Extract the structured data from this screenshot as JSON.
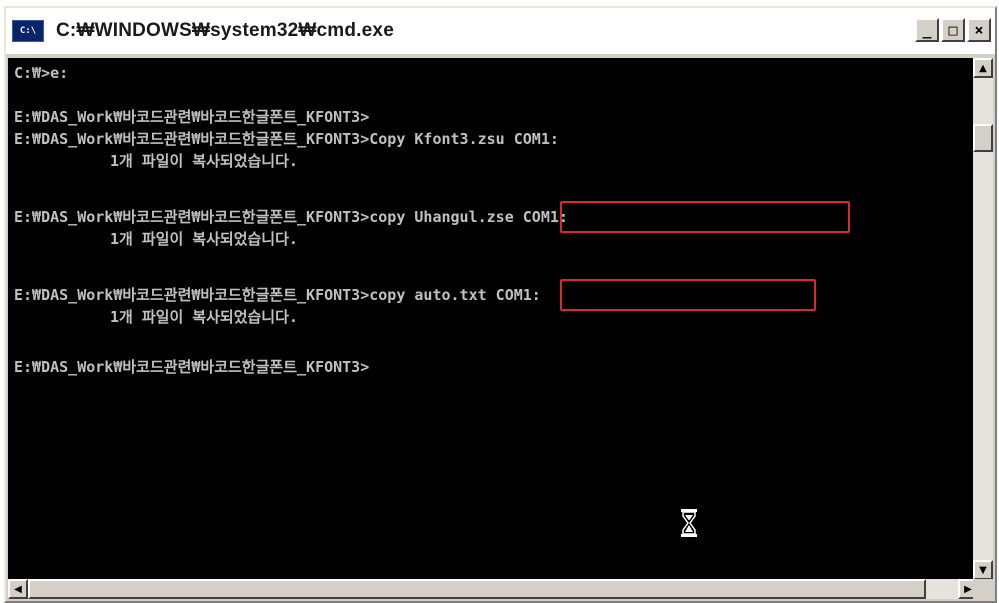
{
  "window": {
    "title": "C:₩WINDOWS₩system32₩cmd.exe",
    "icon": "cmd-console-icon",
    "icon_text": "C:\\",
    "controls": {
      "minimize": "_",
      "maximize": "□",
      "close": "×"
    }
  },
  "console": {
    "lines": [
      "C:₩>e:",
      "",
      "E:₩DAS_Work₩바코드관련₩바코드한글폰트_KFONT3>",
      "E:₩DAS_Work₩바코드관련₩바코드한글폰트_KFONT3>Copy Kfont3.zsu COM1:",
      "1개 파일이 복사되었습니다.",
      "",
      "E:₩DAS_Work₩바코드관련₩바코드한글폰트_KFONT3>copy Uhangul.zse COM1:",
      "1개 파일이 복사되었습니다.",
      "",
      "E:₩DAS_Work₩바코드관련₩바코드한글폰트_KFONT3>copy auto.txt COM1:",
      "1개 파일이 복사되었습니다.",
      "",
      "E:₩DAS_Work₩바코드관련₩바코드한글폰트_KFONT3>"
    ],
    "text_color": "#c0c0c0",
    "background": "#000000",
    "highlight_color": "#e0262d"
  },
  "cursor": {
    "icon": "hourglass-busy-icon"
  },
  "scrollbars": {
    "vertical": {
      "up": "▲",
      "down": "▼"
    },
    "horizontal": {
      "left": "◀",
      "right": "▶"
    }
  }
}
